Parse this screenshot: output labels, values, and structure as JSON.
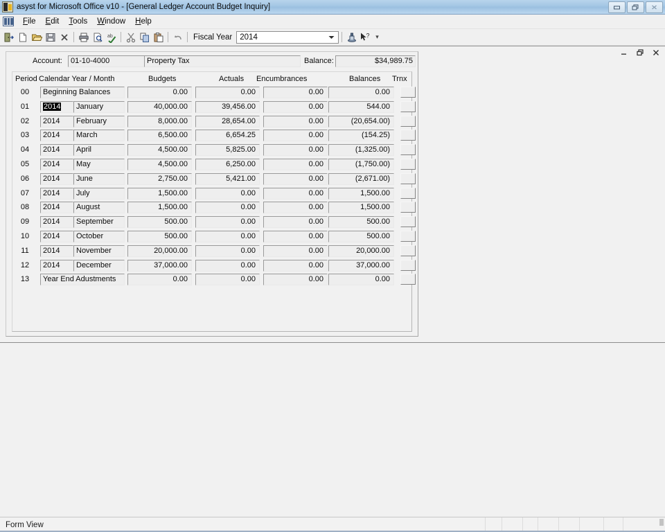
{
  "window": {
    "title": "asyst for Microsoft Office v10 - [General Ledger Account Budget Inquiry]",
    "app_icon": "app-icon",
    "controls": {
      "minimize": "minimize-icon",
      "restore": "restore-icon",
      "close": "close-icon"
    }
  },
  "child_window": {
    "minimize": "minimize-icon",
    "restore": "restore-icon",
    "close": "close-icon"
  },
  "menu": {
    "doc_icon": "document-grid-icon",
    "items": [
      {
        "label": "File",
        "accel": "F"
      },
      {
        "label": "Edit",
        "accel": "E"
      },
      {
        "label": "Tools",
        "accel": "T"
      },
      {
        "label": "Window",
        "accel": "W"
      },
      {
        "label": "Help",
        "accel": "H"
      }
    ]
  },
  "toolbar": {
    "buttons": [
      {
        "name": "exit-door-icon",
        "tip": "Exit"
      },
      {
        "name": "new-file-icon",
        "tip": "New"
      },
      {
        "name": "open-folder-icon",
        "tip": "Open"
      },
      {
        "name": "save-disk-icon",
        "tip": "Save"
      },
      {
        "name": "delete-x-icon",
        "tip": "Delete"
      },
      {
        "name": "print-icon",
        "tip": "Print"
      },
      {
        "name": "print-preview-icon",
        "tip": "Print Preview"
      },
      {
        "name": "spellcheck-icon",
        "tip": "Spelling"
      },
      {
        "name": "cut-scissors-icon",
        "tip": "Cut"
      },
      {
        "name": "copy-icon",
        "tip": "Copy"
      },
      {
        "name": "paste-icon",
        "tip": "Paste"
      },
      {
        "name": "undo-icon",
        "tip": "Undo"
      }
    ],
    "fiscal_year_label": "Fiscal Year",
    "fiscal_year_value": "2014",
    "fiscal_year_options": [
      "2014"
    ],
    "dropdown_icon": "chevron-down-icon",
    "post_icon": "post-stamp-icon",
    "help_icon": "context-help-icon",
    "overflow_icon": "toolbar-overflow-icon"
  },
  "form": {
    "account_label": "Account:",
    "account_number": "01-10-4000",
    "account_name": "Property Tax",
    "balance_label": "Balance:",
    "balance_value": "$34,989.75",
    "columns": [
      "Period",
      "Calendar Year / Month",
      "Budgets",
      "Actuals",
      "Encumbrances",
      "Balances",
      "Trnx"
    ],
    "rows": [
      {
        "period": "00",
        "year": "",
        "month": "Beginning Balances",
        "span": true,
        "budget": "0.00",
        "actual": "0.00",
        "encumbrance": "0.00",
        "balance": "0.00",
        "selected": false,
        "trnx": "trnx-button"
      },
      {
        "period": "01",
        "year": "2014",
        "month": "January",
        "span": false,
        "budget": "40,000.00",
        "actual": "39,456.00",
        "encumbrance": "0.00",
        "balance": "544.00",
        "selected": true,
        "trnx": "trnx-button"
      },
      {
        "period": "02",
        "year": "2014",
        "month": "February",
        "span": false,
        "budget": "8,000.00",
        "actual": "28,654.00",
        "encumbrance": "0.00",
        "balance": "(20,654.00)",
        "selected": false,
        "trnx": "trnx-button"
      },
      {
        "period": "03",
        "year": "2014",
        "month": "March",
        "span": false,
        "budget": "6,500.00",
        "actual": "6,654.25",
        "encumbrance": "0.00",
        "balance": "(154.25)",
        "selected": false,
        "trnx": "trnx-button"
      },
      {
        "period": "04",
        "year": "2014",
        "month": "April",
        "span": false,
        "budget": "4,500.00",
        "actual": "5,825.00",
        "encumbrance": "0.00",
        "balance": "(1,325.00)",
        "selected": false,
        "trnx": "trnx-button"
      },
      {
        "period": "05",
        "year": "2014",
        "month": "May",
        "span": false,
        "budget": "4,500.00",
        "actual": "6,250.00",
        "encumbrance": "0.00",
        "balance": "(1,750.00)",
        "selected": false,
        "trnx": "trnx-button"
      },
      {
        "period": "06",
        "year": "2014",
        "month": "June",
        "span": false,
        "budget": "2,750.00",
        "actual": "5,421.00",
        "encumbrance": "0.00",
        "balance": "(2,671.00)",
        "selected": false,
        "trnx": "trnx-button"
      },
      {
        "period": "07",
        "year": "2014",
        "month": "July",
        "span": false,
        "budget": "1,500.00",
        "actual": "0.00",
        "encumbrance": "0.00",
        "balance": "1,500.00",
        "selected": false,
        "trnx": "trnx-button"
      },
      {
        "period": "08",
        "year": "2014",
        "month": "August",
        "span": false,
        "budget": "1,500.00",
        "actual": "0.00",
        "encumbrance": "0.00",
        "balance": "1,500.00",
        "selected": false,
        "trnx": "trnx-button"
      },
      {
        "period": "09",
        "year": "2014",
        "month": "September",
        "span": false,
        "budget": "500.00",
        "actual": "0.00",
        "encumbrance": "0.00",
        "balance": "500.00",
        "selected": false,
        "trnx": "trnx-button"
      },
      {
        "period": "10",
        "year": "2014",
        "month": "October",
        "span": false,
        "budget": "500.00",
        "actual": "0.00",
        "encumbrance": "0.00",
        "balance": "500.00",
        "selected": false,
        "trnx": "trnx-button"
      },
      {
        "period": "11",
        "year": "2014",
        "month": "November",
        "span": false,
        "budget": "20,000.00",
        "actual": "0.00",
        "encumbrance": "0.00",
        "balance": "20,000.00",
        "selected": false,
        "trnx": "trnx-button"
      },
      {
        "period": "12",
        "year": "2014",
        "month": "December",
        "span": false,
        "budget": "37,000.00",
        "actual": "0.00",
        "encumbrance": "0.00",
        "balance": "37,000.00",
        "selected": false,
        "trnx": "trnx-button"
      },
      {
        "period": "13",
        "year": "",
        "month": "Year End Adustments",
        "span": true,
        "budget": "0.00",
        "actual": "0.00",
        "encumbrance": "0.00",
        "balance": "0.00",
        "selected": false,
        "trnx": "trnx-button"
      }
    ]
  },
  "statusbar": {
    "text": "Form View",
    "panes": [
      "",
      "",
      "",
      "",
      "",
      "",
      "",
      ""
    ]
  },
  "colors": {
    "titlebar": "#a3c6e4",
    "face": "#f0f0f0",
    "field": "#eeeeee",
    "selection_bg": "#000000",
    "selection_fg": "#ffffff"
  }
}
